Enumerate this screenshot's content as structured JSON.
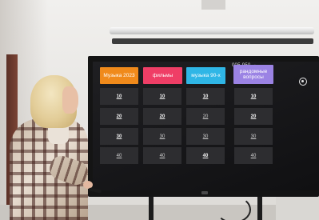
{
  "screen": {
    "status_text": "005-950",
    "status_arrows": "▲ ▾",
    "categories": [
      {
        "label": "Музыка 2023",
        "color": "#f08a1b"
      },
      {
        "label": "фильмы",
        "color": "#ef3e66"
      },
      {
        "label": "музыка 90-х",
        "color": "#2fb6e6"
      },
      {
        "label": "рандомные вопросы",
        "color": "#9b83e4"
      }
    ],
    "grid": {
      "col1": [
        "10",
        "20",
        "30",
        "40"
      ],
      "col2": [
        "10",
        "20",
        "30",
        "40"
      ],
      "col3": [
        "10",
        "20",
        "30",
        "40"
      ],
      "col4": [
        "10",
        "20",
        "30",
        "40"
      ]
    }
  }
}
